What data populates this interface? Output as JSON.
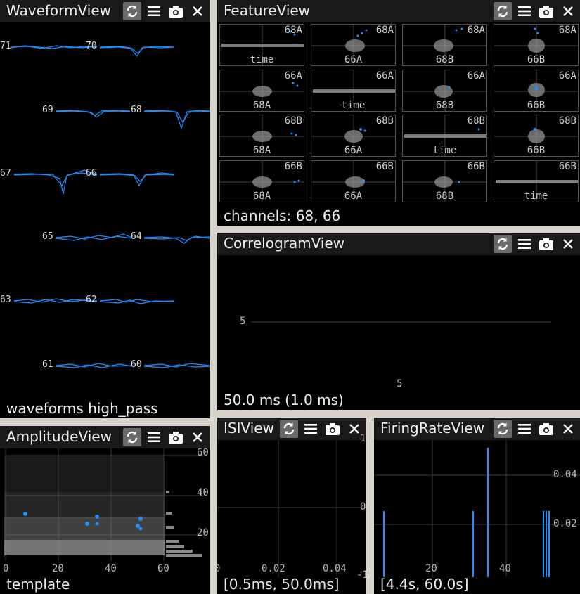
{
  "toolbar_icons": [
    "sync-icon",
    "menu-icon",
    "camera-icon",
    "close-icon"
  ],
  "colors": {
    "accent": "#1e90ff",
    "cluster_gray": "#9a9a9a",
    "background": "#000000",
    "titlebar": "#1a1a1a",
    "frame": "#d8d4cc"
  },
  "waveform_view": {
    "title": "WaveformView",
    "status": "waveforms high_pass",
    "channels": [
      "71",
      "70",
      "69",
      "68",
      "67",
      "66",
      "65",
      "64",
      "63",
      "62",
      "61",
      "60"
    ]
  },
  "feature_view": {
    "title": "FeatureView",
    "status": "channels: 68, 66",
    "grid": [
      [
        {
          "x": "time",
          "y": "68A"
        },
        {
          "x": "66A",
          "y": "68A"
        },
        {
          "x": "68B",
          "y": "68A"
        },
        {
          "x": "66B",
          "y": "68A"
        }
      ],
      [
        {
          "x": "68A",
          "y": "66A"
        },
        {
          "x": "time",
          "y": "66A"
        },
        {
          "x": "68B",
          "y": "66A"
        },
        {
          "x": "66B",
          "y": "66A"
        }
      ],
      [
        {
          "x": "68A",
          "y": "68B"
        },
        {
          "x": "66A",
          "y": "68B"
        },
        {
          "x": "time",
          "y": "68B"
        },
        {
          "x": "66B",
          "y": "68B"
        }
      ],
      [
        {
          "x": "68A",
          "y": "66B"
        },
        {
          "x": "66A",
          "y": "66B"
        },
        {
          "x": "68B",
          "y": "66B"
        },
        {
          "x": "time",
          "y": "66B"
        }
      ]
    ]
  },
  "correlogram_view": {
    "title": "CorrelogramView",
    "status": "50.0 ms (1.0 ms)",
    "y_tick": "5",
    "x_tick": "5"
  },
  "amplitude_view": {
    "title": "AmplitudeView",
    "status": "template",
    "x_ticks": [
      "0",
      "20",
      "40",
      "60"
    ],
    "y_ticks": [
      "60",
      "40",
      "20"
    ]
  },
  "isi_view": {
    "title": "ISIView",
    "status": "[0.5ms, 50.0ms]",
    "x_ticks": [
      "0",
      "0.02",
      "0.04"
    ],
    "y_ticks": [
      "1",
      "0",
      "-1"
    ]
  },
  "firing_rate_view": {
    "title": "FiringRateView",
    "status": "[4.4s, 60.0s]",
    "x_ticks": [
      "20",
      "40"
    ],
    "y_ticks": [
      "0.04",
      "0.02"
    ]
  }
}
